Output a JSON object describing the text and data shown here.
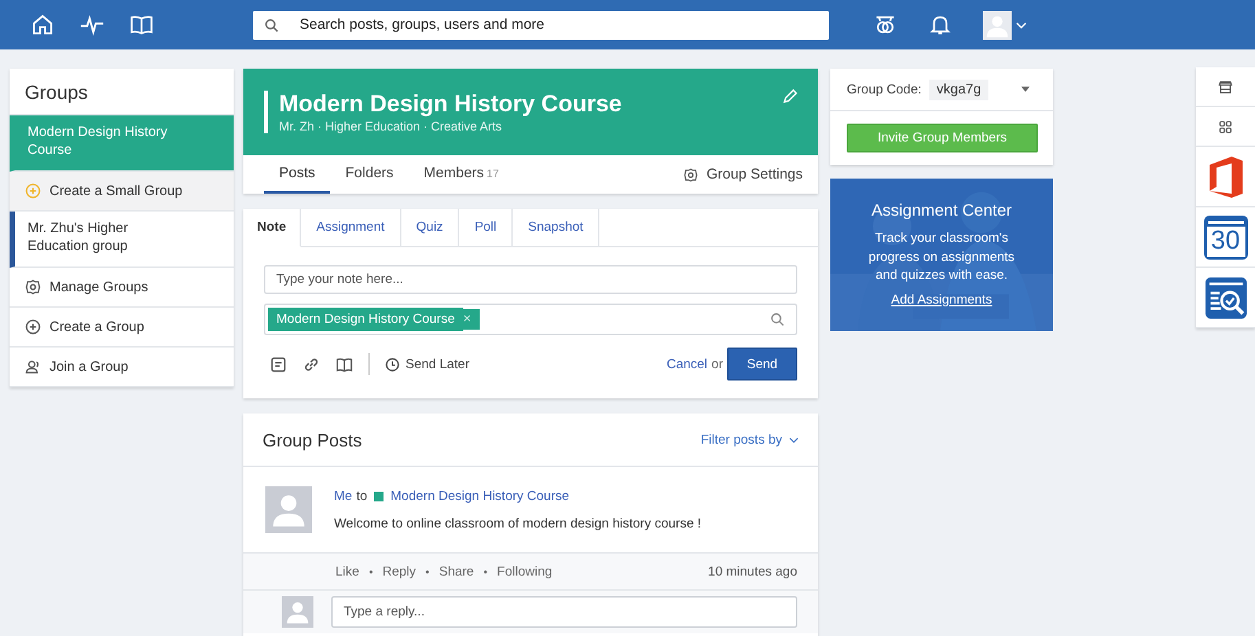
{
  "topbar": {
    "search": {
      "placeholder": "Search posts, groups, users and more"
    }
  },
  "sidebar": {
    "title": "Groups",
    "items": [
      {
        "kind": "group",
        "label": "Modern Design History Course",
        "selected": true,
        "color": "#25a88a"
      },
      {
        "kind": "small",
        "label": "Create a Small Group"
      },
      {
        "kind": "group",
        "label": "Mr. Zhu's Higher Education group",
        "selected": false,
        "color": "#2b579a"
      },
      {
        "kind": "manage",
        "label": "Manage Groups"
      },
      {
        "kind": "create",
        "label": "Create a Group"
      },
      {
        "kind": "join",
        "label": "Join a Group"
      }
    ]
  },
  "group_header": {
    "title": "Modern Design History Course",
    "subtitle": "Mr. Zh · Higher Education · Creative Arts"
  },
  "group_tabs": [
    {
      "label": "Posts",
      "selected": true
    },
    {
      "label": "Folders",
      "selected": false
    },
    {
      "label": "Members",
      "count": "17",
      "selected": false
    }
  ],
  "group_settings": "Group Settings",
  "composer": {
    "tabs": [
      {
        "label": "Note",
        "selected": true
      },
      {
        "label": "Assignment",
        "selected": false
      },
      {
        "label": "Quiz",
        "selected": false
      },
      {
        "label": "Poll",
        "selected": false
      },
      {
        "label": "Snapshot",
        "selected": false
      }
    ],
    "note": {
      "placeholder": "Type your note here..."
    },
    "recipient": {
      "label": "Modern Design History Course",
      "remove": "×"
    },
    "send_later": "Send Later",
    "cancel": "Cancel",
    "or": "or",
    "send": "Send"
  },
  "group_posts": {
    "title": "Group Posts",
    "filter": "Filter posts by",
    "post": {
      "author": "Me",
      "to": "to",
      "group": "Modern Design History Course",
      "text": "Welcome to online classroom of modern design history course !",
      "actions": [
        "Like",
        "Reply",
        "Share",
        "Following"
      ],
      "separator": "•",
      "time": "10 minutes ago"
    },
    "reply": {
      "placeholder": "Type a reply..."
    }
  },
  "group_code": {
    "label": "Group Code:",
    "value": "vkga7g"
  },
  "invite": "Invite Group Members",
  "promo": {
    "title": "Assignment Center",
    "text": "Track your classroom's progress on assignments and quizzes with ease.",
    "link": "Add Assignments"
  },
  "dock": {
    "calendar_day": "30"
  }
}
